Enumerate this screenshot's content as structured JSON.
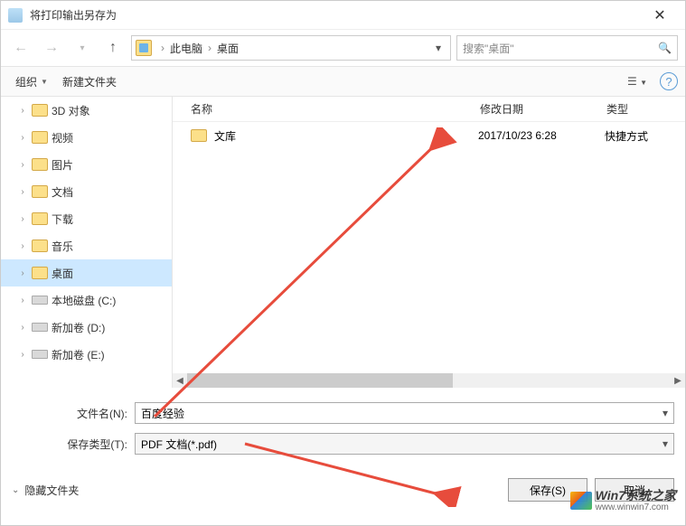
{
  "title": "将打印输出另存为",
  "breadcrumb": {
    "pc": "此电脑",
    "desktop": "桌面"
  },
  "search": {
    "placeholder": "搜索\"桌面\""
  },
  "toolbar": {
    "organize": "组织",
    "newfolder": "新建文件夹"
  },
  "sidebar": {
    "items": [
      {
        "label": "3D 对象"
      },
      {
        "label": "视频"
      },
      {
        "label": "图片"
      },
      {
        "label": "文档"
      },
      {
        "label": "下载"
      },
      {
        "label": "音乐"
      },
      {
        "label": "桌面"
      },
      {
        "label": "本地磁盘 (C:)"
      },
      {
        "label": "新加卷 (D:)"
      },
      {
        "label": "新加卷 (E:)"
      }
    ]
  },
  "columns": {
    "name": "名称",
    "modified": "修改日期",
    "type": "类型"
  },
  "rows": [
    {
      "name": "文库",
      "modified": "2017/10/23 6:28",
      "type": "快捷方式"
    }
  ],
  "filename_label": "文件名(N):",
  "filename_value": "百度经验",
  "filetype_label": "保存类型(T):",
  "filetype_value": "PDF 文档(*.pdf)",
  "hide_folders": "隐藏文件夹",
  "save": "保存(S)",
  "cancel": "取消",
  "watermark": {
    "line1": "Win7系统之家",
    "line2": "www.winwin7.com"
  }
}
